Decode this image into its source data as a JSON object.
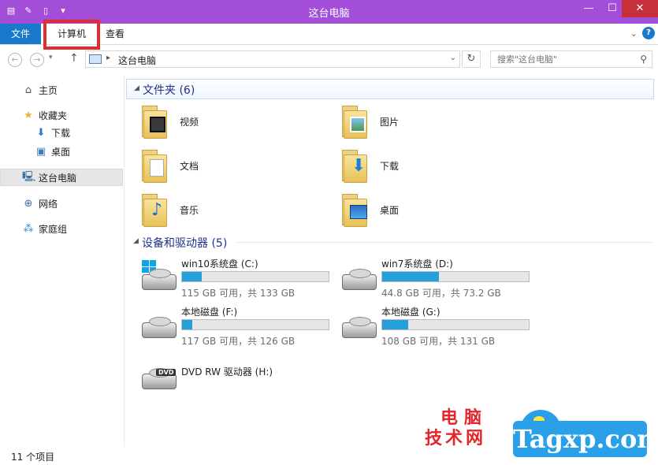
{
  "window": {
    "title": "这台电脑",
    "controls": {
      "minimize": "—",
      "maximize": "☐",
      "close": "✕"
    }
  },
  "ribbon": {
    "tabs": [
      {
        "label": "文件"
      },
      {
        "label": "计算机"
      },
      {
        "label": "查看"
      }
    ],
    "collapse_icon": "chevron-down-icon",
    "help_label": "?"
  },
  "address_bar": {
    "breadcrumb": "这台电脑",
    "search_placeholder": "搜索\"这台电脑\""
  },
  "sidebar": {
    "items": [
      {
        "label": "主页",
        "icon": "home-icon"
      },
      {
        "label": "收藏夹",
        "icon": "star-icon"
      },
      {
        "label": "下载",
        "icon": "download-folder-icon"
      },
      {
        "label": "桌面",
        "icon": "desktop-icon"
      },
      {
        "label": "这台电脑",
        "icon": "computer-icon",
        "selected": true
      },
      {
        "label": "网络",
        "icon": "network-icon"
      },
      {
        "label": "家庭组",
        "icon": "homegroup-icon"
      }
    ]
  },
  "groups": {
    "folders": {
      "title": "文件夹 (6)",
      "items": [
        {
          "name": "视频",
          "icon": "videos-folder-icon"
        },
        {
          "name": "图片",
          "icon": "pictures-folder-icon"
        },
        {
          "name": "文档",
          "icon": "documents-folder-icon"
        },
        {
          "name": "下载",
          "icon": "downloads-folder-icon"
        },
        {
          "name": "音乐",
          "icon": "music-folder-icon"
        },
        {
          "name": "桌面",
          "icon": "desktop-folder-icon"
        }
      ]
    },
    "drives": {
      "title": "设备和驱动器 (5)",
      "items": [
        {
          "name": "win10系统盘 (C:)",
          "size": "115 GB 可用，共 133 GB",
          "used_fraction": 0.135
        },
        {
          "name": "win7系统盘 (D:)",
          "size": "44.8 GB 可用，共 73.2 GB",
          "used_fraction": 0.388
        },
        {
          "name": "本地磁盘 (F:)",
          "size": "117 GB 可用，共 126 GB",
          "used_fraction": 0.071
        },
        {
          "name": "本地磁盘 (G:)",
          "size": "108 GB 可用，共 131 GB",
          "used_fraction": 0.176
        },
        {
          "name": "DVD RW 驱动器 (H:)",
          "dvd_label": "DVD"
        }
      ]
    }
  },
  "status": {
    "item_count": "11 个项目"
  },
  "watermark": {
    "line1": "电脑",
    "line2": "技术网",
    "site": "Tagxp.com"
  },
  "colors": {
    "titlebar": "#a24ed8",
    "file_tab": "#1979ca",
    "highlight": "#e02d2d",
    "progress": "#26a0da"
  }
}
